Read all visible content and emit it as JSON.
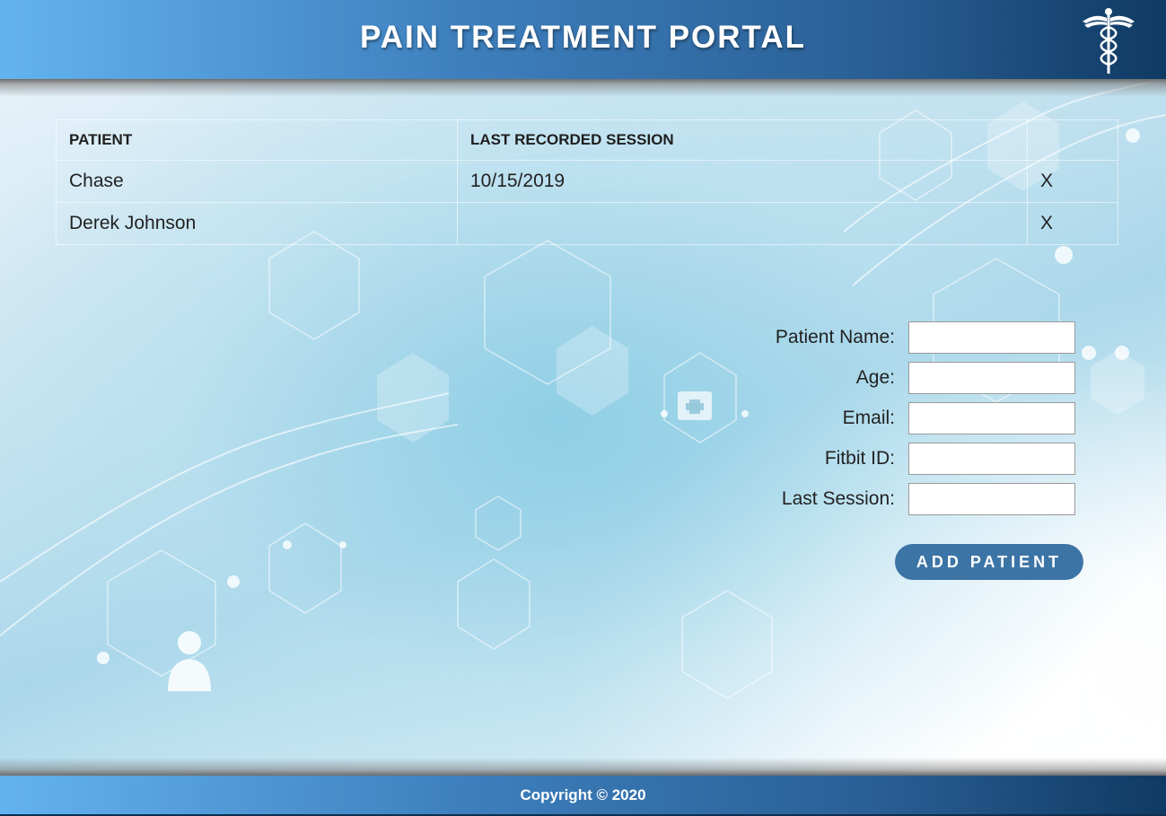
{
  "header": {
    "title": "PAIN TREATMENT PORTAL",
    "logo_icon": "caduceus-icon"
  },
  "table": {
    "headers": [
      "PATIENT",
      "LAST RECORDED SESSION",
      ""
    ],
    "rows": [
      {
        "name": "Chase",
        "last_session": "10/15/2019",
        "delete": "X"
      },
      {
        "name": "Derek Johnson",
        "last_session": "",
        "delete": "X"
      }
    ]
  },
  "form": {
    "patient_name_label": "Patient Name:",
    "age_label": "Age:",
    "email_label": "Email:",
    "fitbit_label": "Fitbit ID:",
    "last_session_label": "Last Session:",
    "patient_name_value": "",
    "age_value": "",
    "email_value": "",
    "fitbit_value": "",
    "last_session_value": "",
    "submit_label": "ADD PATIENT"
  },
  "footer": {
    "copyright": "Copyright © 2020"
  },
  "colors": {
    "header_light": "#63b3ef",
    "header_dark": "#0f3a63",
    "button": "#3c74a6"
  }
}
